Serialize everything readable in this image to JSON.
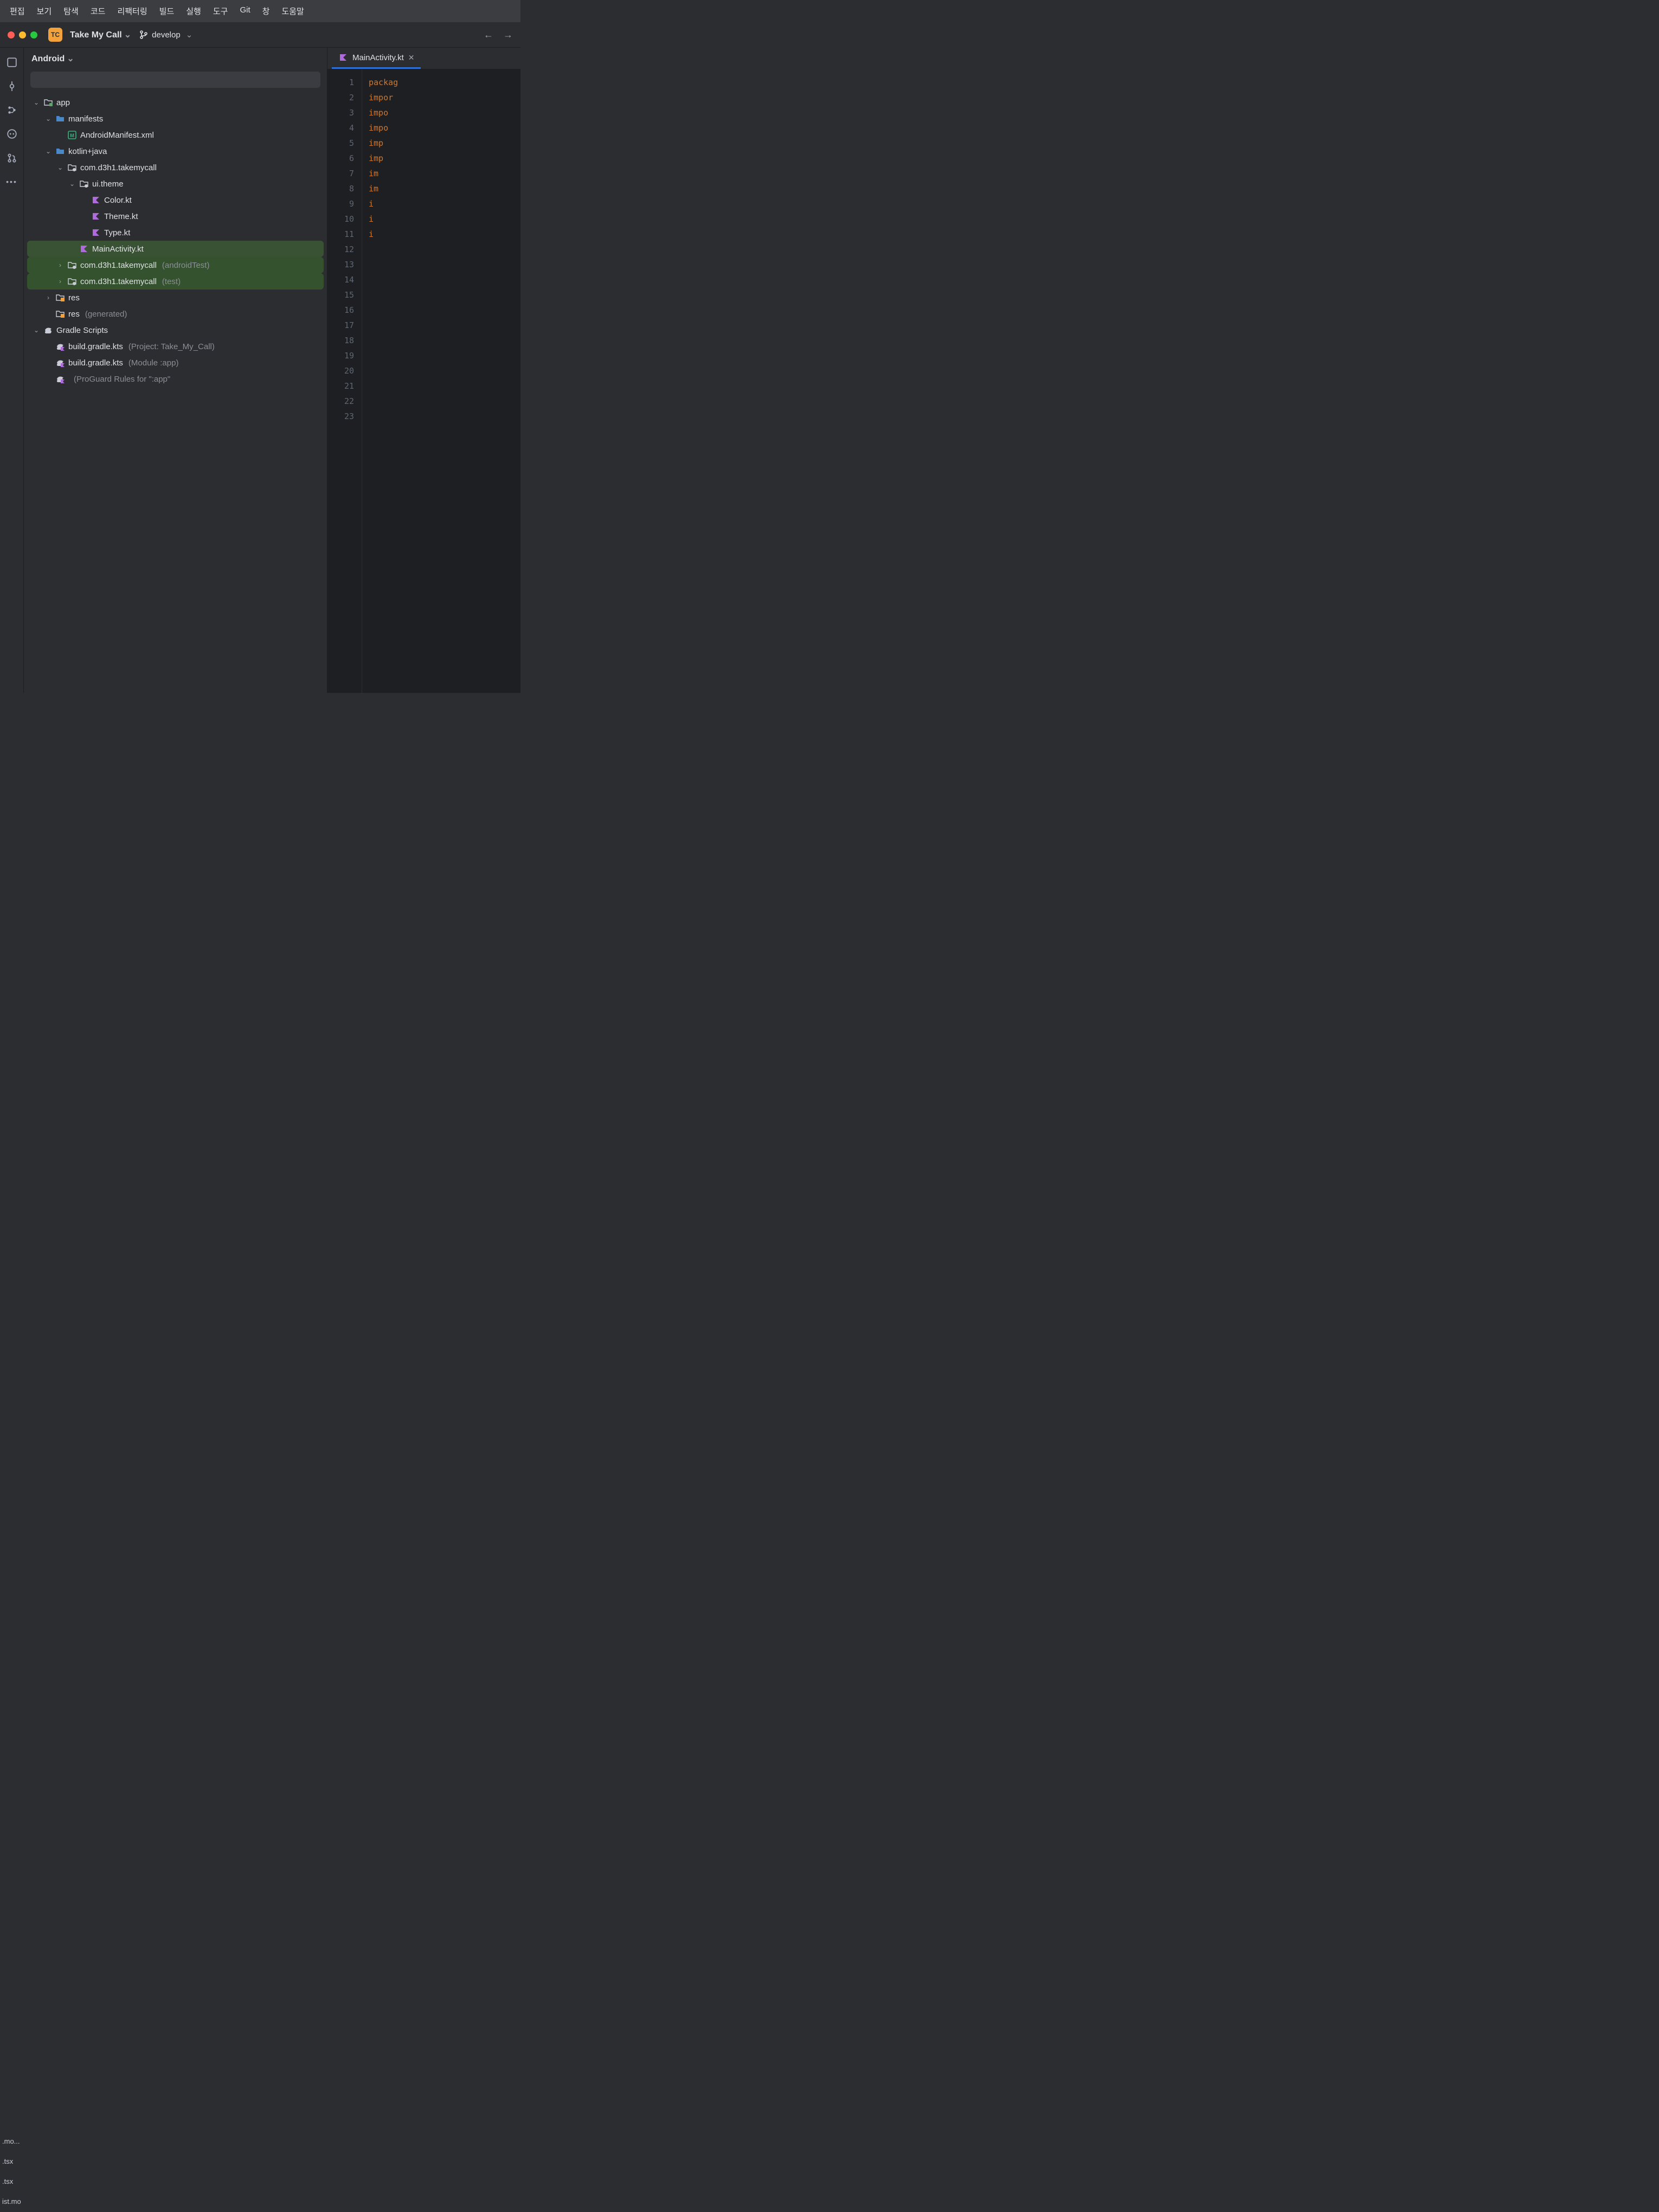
{
  "menubar": [
    "편집",
    "보기",
    "탐색",
    "코드",
    "리팩터링",
    "빌드",
    "실행",
    "도구",
    "Git",
    "창",
    "도움말"
  ],
  "titlebar": {
    "project_badge": "TC",
    "project_name": "Take My Call",
    "branch": "develop",
    "nav_back": "←",
    "nav_fwd": "→"
  },
  "toolstrip_labels": [
    ".mo...",
    ".tsx",
    ".tsx",
    "ist.mo"
  ],
  "project_panel": {
    "scope": "Android"
  },
  "tree": [
    {
      "depth": 0,
      "arrow": "open",
      "icon": "module",
      "label": "app"
    },
    {
      "depth": 1,
      "arrow": "open",
      "icon": "folder-blue",
      "label": "manifests"
    },
    {
      "depth": 2,
      "arrow": "none",
      "icon": "xml",
      "label": "AndroidManifest.xml"
    },
    {
      "depth": 1,
      "arrow": "open",
      "icon": "folder-blue",
      "label": "kotlin+java"
    },
    {
      "depth": 2,
      "arrow": "open",
      "icon": "package",
      "label": "com.d3h1.takemycall"
    },
    {
      "depth": 3,
      "arrow": "open",
      "icon": "package",
      "label": "ui.theme"
    },
    {
      "depth": 4,
      "arrow": "none",
      "icon": "kt",
      "label": "Color.kt"
    },
    {
      "depth": 4,
      "arrow": "none",
      "icon": "kt",
      "label": "Theme.kt"
    },
    {
      "depth": 4,
      "arrow": "none",
      "icon": "kt",
      "label": "Type.kt"
    },
    {
      "depth": 3,
      "arrow": "none",
      "icon": "kt",
      "label": "MainActivity.kt",
      "sel": true
    },
    {
      "depth": 2,
      "arrow": "closed",
      "icon": "package",
      "label": "com.d3h1.takemycall",
      "suffix": "(androidTest)",
      "green": true
    },
    {
      "depth": 2,
      "arrow": "closed",
      "icon": "package",
      "label": "com.d3h1.takemycall",
      "suffix": "(test)",
      "green": true
    },
    {
      "depth": 1,
      "arrow": "closed",
      "icon": "res",
      "label": "res"
    },
    {
      "depth": 1,
      "arrow": "none",
      "icon": "res",
      "label": "res",
      "suffix": "(generated)"
    },
    {
      "depth": 0,
      "arrow": "open",
      "icon": "gradle",
      "label": "Gradle Scripts"
    },
    {
      "depth": 1,
      "arrow": "none",
      "icon": "gradle-file",
      "label": "build.gradle.kts",
      "suffix": "(Project: Take_My_Call)"
    },
    {
      "depth": 1,
      "arrow": "none",
      "icon": "gradle-file",
      "label": "build.gradle.kts",
      "suffix": "(Module :app)"
    },
    {
      "depth": 1,
      "arrow": "none",
      "icon": "gradle-file",
      "label": "",
      "suffix": "(ProGuard Rules for \":app\""
    }
  ],
  "editor": {
    "tab_file": "MainActivity.kt",
    "line_count": 23,
    "visible_tokens": [
      "packag",
      "",
      "impor",
      "impo",
      "impo",
      "imp",
      "imp",
      "im",
      "im",
      "i",
      "i",
      "i"
    ]
  }
}
